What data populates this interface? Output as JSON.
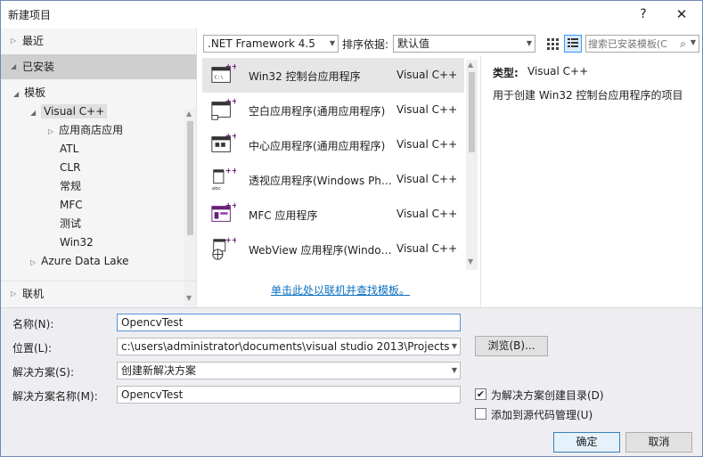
{
  "window": {
    "title": "新建项目",
    "help": "?",
    "close": "✕"
  },
  "nav": {
    "recent": "最近",
    "installed": "已安装",
    "online": "联机",
    "tree": [
      {
        "label": "模板",
        "level": 0,
        "arrow": "◢"
      },
      {
        "label": "Visual C++",
        "level": 1,
        "arrow": "◢",
        "selected": true
      },
      {
        "label": "应用商店应用",
        "level": 2,
        "arrow": "▷"
      },
      {
        "label": "ATL",
        "level": 2
      },
      {
        "label": "CLR",
        "level": 2
      },
      {
        "label": "常规",
        "level": 2
      },
      {
        "label": "MFC",
        "level": 2
      },
      {
        "label": "测试",
        "level": 2
      },
      {
        "label": "Win32",
        "level": 2
      },
      {
        "label": "Azure Data Lake",
        "level": 1,
        "arrow": "▷"
      }
    ]
  },
  "toolbar": {
    "framework": ".NET Framework 4.5",
    "sort_label": "排序依据:",
    "sort_value": "默认值",
    "search_placeholder": "搜索已安装模板(C",
    "search_icon": "⌕"
  },
  "templates": [
    {
      "name": "Win32 控制台应用程序",
      "lang": "Visual C++",
      "icon": "console",
      "selected": true
    },
    {
      "name": "空白应用程序(通用应用程序)",
      "lang": "Visual C++",
      "icon": "blank"
    },
    {
      "name": "中心应用程序(通用应用程序)",
      "lang": "Visual C++",
      "icon": "hub"
    },
    {
      "name": "透视应用程序(Windows Phone)",
      "lang": "Visual C++",
      "icon": "pivot"
    },
    {
      "name": "MFC 应用程序",
      "lang": "Visual C++",
      "icon": "mfc"
    },
    {
      "name": "WebView 应用程序(Windows Phone)",
      "lang": "Visual C++",
      "icon": "webview"
    }
  ],
  "online_link": "单击此处以联机并查找模板。",
  "description": {
    "type_key": "类型:",
    "type_value": "Visual C++",
    "text": "用于创建 Win32 控制台应用程序的项目"
  },
  "form": {
    "name_label": "名称(N):",
    "name_value": "OpencvTest",
    "location_label": "位置(L):",
    "location_value": "c:\\users\\administrator\\documents\\visual studio 2013\\Projects",
    "browse_button": "浏览(B)...",
    "solution_label": "解决方案(S):",
    "solution_value": "创建新解决方案",
    "solution_name_label": "解决方案名称(M):",
    "solution_name_value": "OpencvTest",
    "create_dir_label": "为解决方案创建目录(D)",
    "create_dir_checked": true,
    "source_control_label": "添加到源代码管理(U)",
    "source_control_checked": false,
    "ok_button": "确定",
    "cancel_button": "取消"
  }
}
